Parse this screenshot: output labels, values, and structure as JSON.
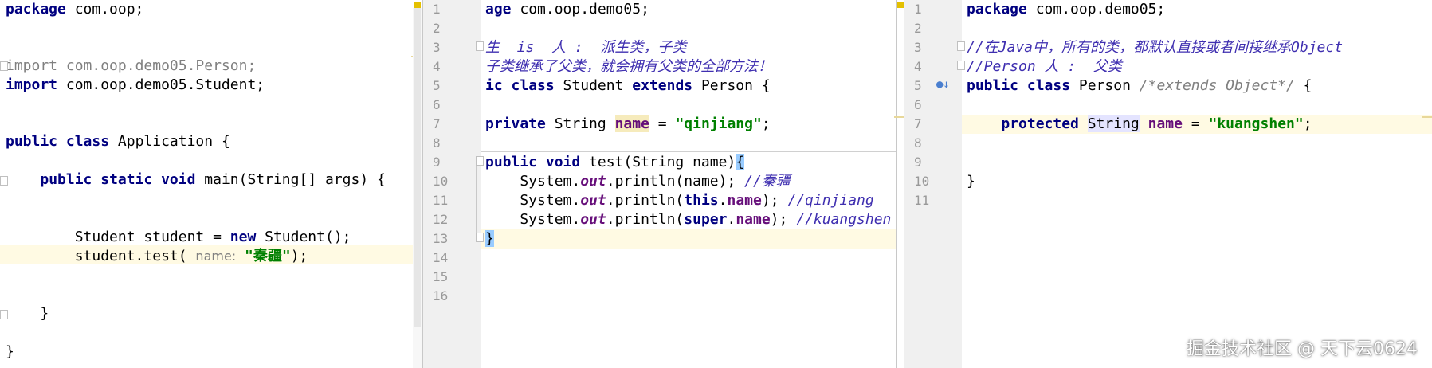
{
  "left_pane": {
    "lines": {
      "l1_pkg": "package",
      "l1_rest": " com.oop;",
      "l4_import": "import",
      "l4_rest": " com.oop.demo05.Person;",
      "l5_import": "import",
      "l5_rest": " com.oop.demo05.Student;",
      "l8_public": "public",
      "l8_class": " class",
      "l8_rest": " Application {",
      "l10_indent": "    ",
      "l10_public": "public",
      "l10_static": " static",
      "l10_void": " void",
      "l10_rest": " main(String[] args) {",
      "l13_a": "        Student student = ",
      "l13_new": "new",
      "l13_b": " Student();",
      "l14_a": "        student.test( ",
      "l14_hint": "name:",
      "l14_str": " \"秦疆\"",
      "l14_b": ");",
      "l17": "    }",
      "l19": "}"
    }
  },
  "middle_pane": {
    "line_numbers": [
      "1",
      "2",
      "3",
      "4",
      "5",
      "6",
      "7",
      "8",
      "9",
      "10",
      "11",
      "12",
      "13",
      "14",
      "15",
      "16"
    ],
    "lines": {
      "l1_a": "age",
      "l1_b": " com.oop.demo05;",
      "l3": "生  is  人 :  派生类，子类",
      "l4": "子类继承了父类，就会拥有父类的全部方法！",
      "l5_a": "ic",
      "l5_class": " class",
      "l5_b": " Student ",
      "l5_extends": "extends",
      "l5_c": " Person {",
      "l7_private": "private",
      "l7_a": " String ",
      "l7_name": "name",
      "l7_b": " = ",
      "l7_str": "\"qinjiang\"",
      "l7_c": ";",
      "l9_public": "public",
      "l9_void": " void",
      "l9_a": " test(String name)",
      "l9_brace": "{",
      "l10_a": "    System.",
      "l10_out": "out",
      "l10_b": ".println(name); ",
      "l10_cmt": "//秦疆",
      "l11_a": "    System.",
      "l11_out": "out",
      "l11_b": ".println(",
      "l11_this": "this",
      "l11_c": ".",
      "l11_name": "name",
      "l11_d": "); ",
      "l11_cmt": "//qinjiang",
      "l12_a": "    System.",
      "l12_out": "out",
      "l12_b": ".println(",
      "l12_super": "super",
      "l12_c": ".",
      "l12_name": "name",
      "l12_d": "); ",
      "l12_cmt": "//kuangshen",
      "l13_brace": "}"
    }
  },
  "right_pane": {
    "line_numbers": [
      "1",
      "2",
      "3",
      "4",
      "5",
      "6",
      "7",
      "8",
      "9",
      "10",
      "11"
    ],
    "lines": {
      "l1_pkg": "package",
      "l1_rest": " com.oop.demo05;",
      "l3_cmt": "//在Java中，所有的类，都默认直接或者间接继承Object",
      "l4_cmt": "//Person 人 :  父类",
      "l5_public": "public",
      "l5_class": " class",
      "l5_a": " Person ",
      "l5_cmt": "/*extends Object*/",
      "l5_b": " {",
      "l7_indent": "    ",
      "l7_protected": "protected",
      "l7_a": " ",
      "l7_type": "String",
      "l7_b": " ",
      "l7_name": "name",
      "l7_c": " = ",
      "l7_str": "\"kuangshen\"",
      "l7_d": ";",
      "l10": "}"
    }
  },
  "watermark": "掘金技术社区 @ 天下云0624",
  "colors": {
    "keyword": "#000080",
    "string": "#008000",
    "comment": "#3f2fb0",
    "field": "#660e7a",
    "gutter": "#f0f0f0"
  },
  "icons": {
    "override": "override-gutter-icon",
    "warning": "warning-marker-icon"
  }
}
